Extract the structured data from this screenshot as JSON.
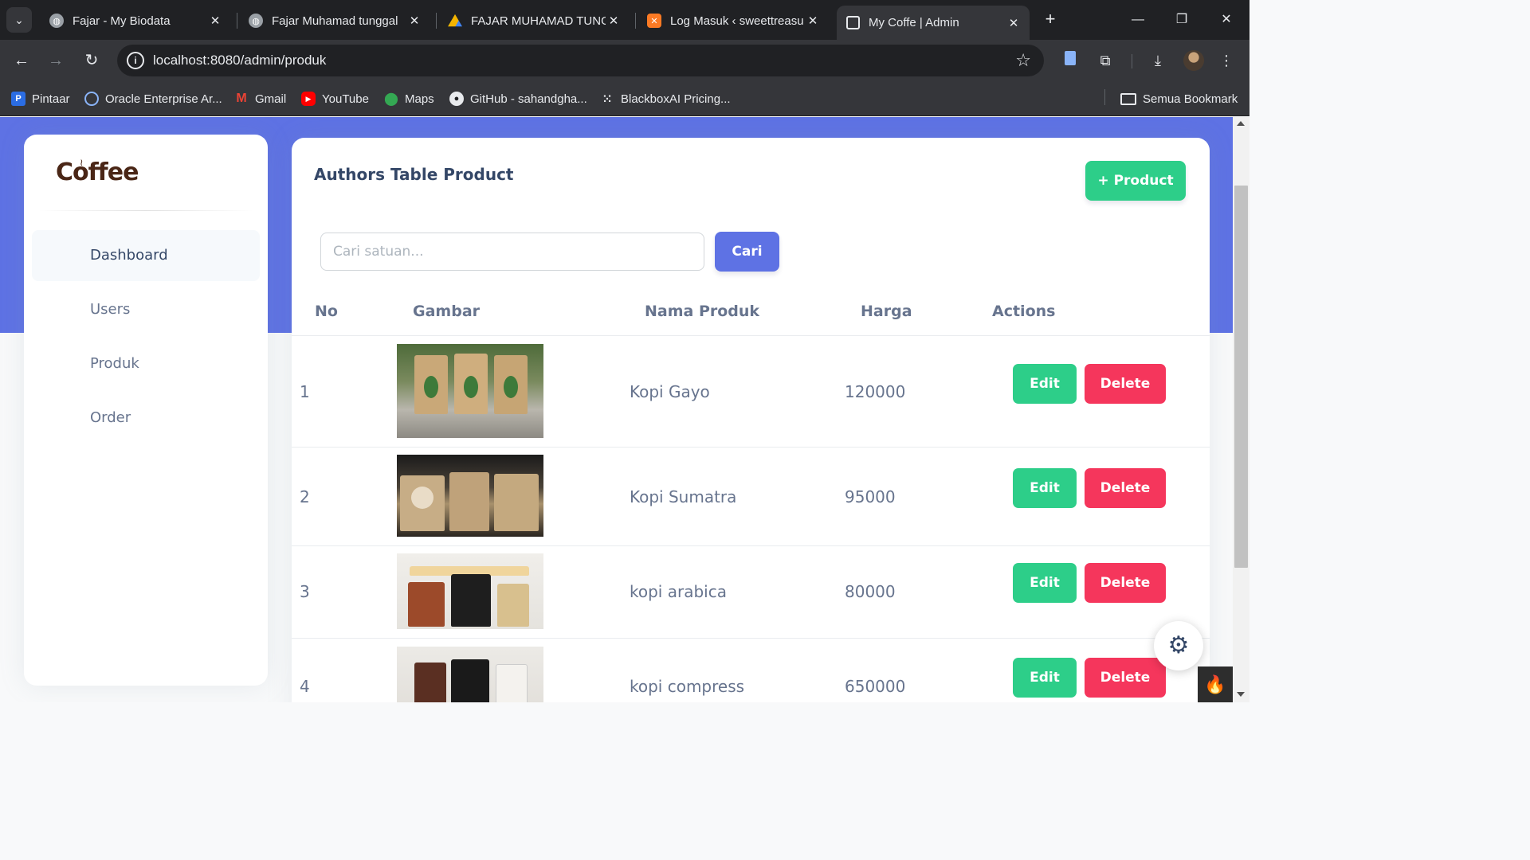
{
  "browser": {
    "tabs": [
      {
        "title": "Fajar - My Biodata",
        "icon": "globe-icon"
      },
      {
        "title": "Fajar Muhamad tunggal",
        "icon": "globe-icon"
      },
      {
        "title": "FAJAR MUHAMAD TUNG",
        "icon": "google-drive-icon"
      },
      {
        "title": "Log Masuk ‹ sweettreasu",
        "icon": "xampp-icon"
      },
      {
        "title": "My Coffe | Admin",
        "icon": "page-icon"
      }
    ],
    "url": "localhost:8080/admin/produk",
    "bookmarks": [
      {
        "label": "Pintaar",
        "icon": "pintaar-icon"
      },
      {
        "label": "Oracle Enterprise Ar...",
        "icon": "oracle-icon"
      },
      {
        "label": "Gmail",
        "icon": "gmail-icon"
      },
      {
        "label": "YouTube",
        "icon": "youtube-icon"
      },
      {
        "label": "Maps",
        "icon": "maps-icon"
      },
      {
        "label": "GitHub - sahandgha...",
        "icon": "github-icon"
      },
      {
        "label": "BlackboxAI Pricing...",
        "icon": "blackbox-icon"
      }
    ],
    "all_bookmarks_label": "Semua Bookmark"
  },
  "sidebar": {
    "logo_text": "Coffee",
    "items": [
      {
        "label": "Dashboard",
        "active": true
      },
      {
        "label": "Users",
        "active": false
      },
      {
        "label": "Produk",
        "active": false
      },
      {
        "label": "Order",
        "active": false
      }
    ]
  },
  "main": {
    "title": "Authors Table Product",
    "add_button": "+ Product",
    "search_placeholder": "Cari satuan...",
    "search_value": "",
    "search_button": "Cari",
    "columns": [
      "No",
      "Gambar",
      "Nama Produk",
      "Harga",
      "Actions"
    ],
    "edit_label": "Edit",
    "delete_label": "Delete",
    "rows": [
      {
        "no": "1",
        "name": "Kopi Gayo",
        "price": "120000"
      },
      {
        "no": "2",
        "name": "Kopi Sumatra",
        "price": "95000"
      },
      {
        "no": "3",
        "name": "kopi arabica",
        "price": "80000"
      },
      {
        "no": "4",
        "name": "kopi compress",
        "price": "650000"
      }
    ]
  },
  "colors": {
    "primary": "#5e72e4",
    "success": "#2dce89",
    "danger": "#f5365c",
    "text_dark": "#344767",
    "text_muted": "#67748e"
  }
}
